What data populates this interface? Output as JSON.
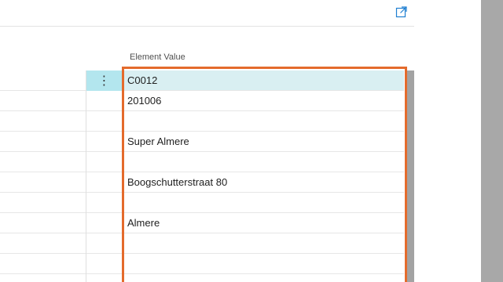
{
  "header": {
    "expand_icon": "expand-arrow-icon"
  },
  "grid": {
    "column_header": "Element Value",
    "row_menu_glyph": "⋮",
    "rows": [
      {
        "value": "C0012",
        "selected": true
      },
      {
        "value": "201006"
      },
      {
        "value": ""
      },
      {
        "value": "Super Almere"
      },
      {
        "value": ""
      },
      {
        "value": "Boogschutterstraat 80"
      },
      {
        "value": ""
      },
      {
        "value": "Almere"
      },
      {
        "value": ""
      },
      {
        "value": ""
      },
      {
        "value": ""
      }
    ]
  },
  "colors": {
    "highlight": "#e46b2c",
    "selected_row": "#d9eff2",
    "selected_menu": "#b3e6ee",
    "expand_icon": "#1f7fd1",
    "scrollbar": "#a8a8a8"
  }
}
